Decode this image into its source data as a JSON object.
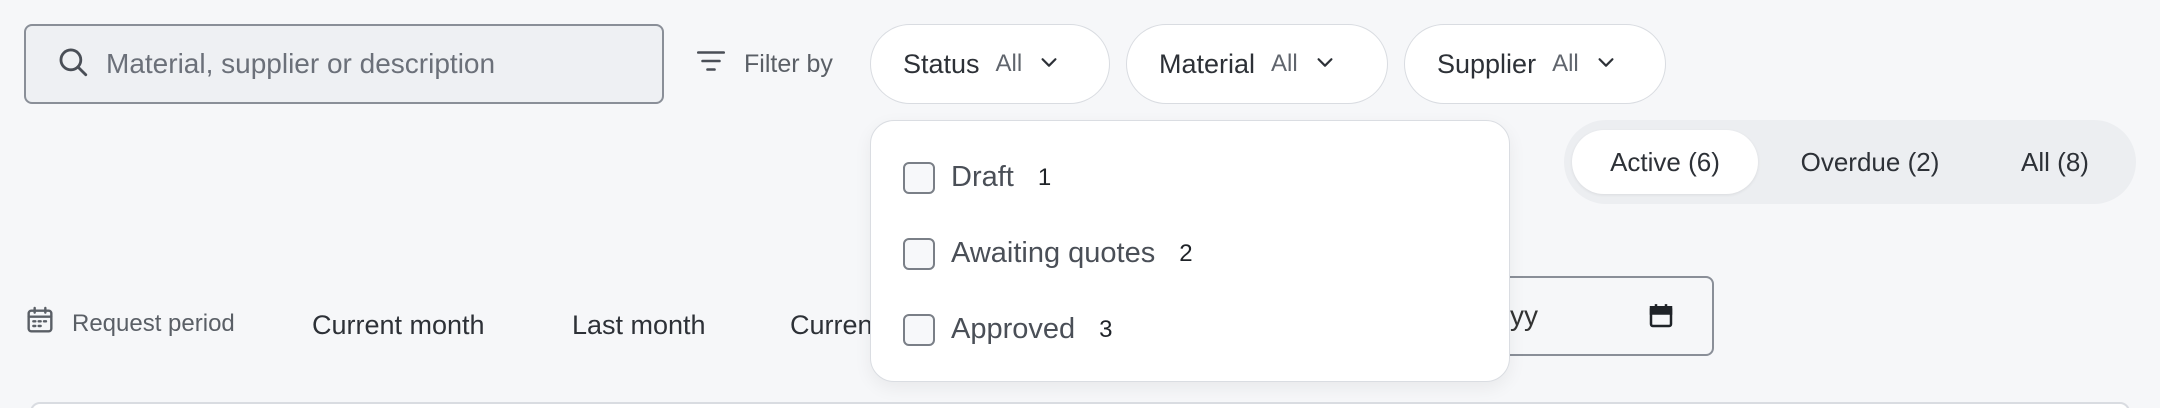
{
  "search": {
    "placeholder": "Material, supplier or description",
    "icon": "search-icon"
  },
  "filter_by": {
    "label": "Filter by",
    "icon": "filter-lines-icon"
  },
  "filters": [
    {
      "label": "Status",
      "value": "All"
    },
    {
      "label": "Material",
      "value": "All"
    },
    {
      "label": "Supplier",
      "value": "All"
    }
  ],
  "status_dropdown": {
    "options": [
      {
        "label": "Draft",
        "count": "1",
        "checked": false
      },
      {
        "label": "Awaiting quotes",
        "count": "2",
        "checked": false
      },
      {
        "label": "Approved",
        "count": "3",
        "checked": false
      }
    ]
  },
  "segments": {
    "active": "Active (6)",
    "overdue": "Overdue (2)",
    "all": "All (8)",
    "selected": "Active (6)"
  },
  "period": {
    "label": "Request period",
    "icon": "calendar-icon",
    "options": [
      "Current month",
      "Last month",
      "Current"
    ]
  },
  "date_input": {
    "visible_text": "yyyy"
  },
  "colors": {
    "background": "#f6f7f9",
    "surface": "#ffffff",
    "border": "#d9dce1",
    "text": "#1f2328",
    "muted": "#5a5f66"
  }
}
